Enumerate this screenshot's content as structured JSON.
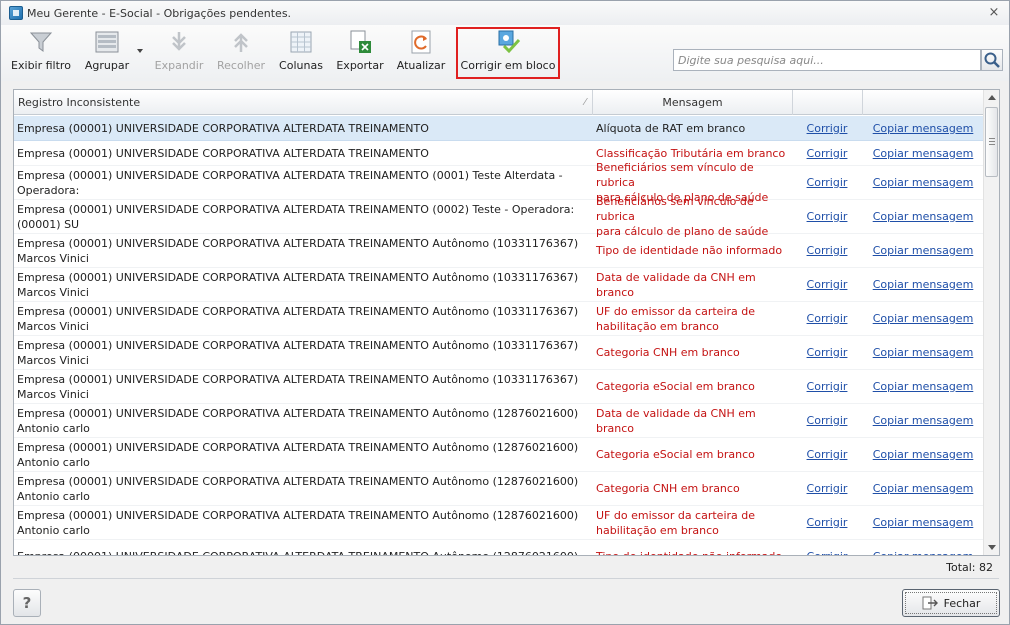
{
  "window": {
    "title": "Meu Gerente - E-Social - Obrigações pendentes.",
    "close_glyph": "×"
  },
  "toolbar": {
    "buttons": [
      {
        "label": "Exibir filtro",
        "icon": "funnel-icon",
        "enabled": true
      },
      {
        "label": "Agrupar",
        "icon": "group-icon",
        "enabled": true
      },
      {
        "label": "Expandir",
        "icon": "expand-icon",
        "enabled": false
      },
      {
        "label": "Recolher",
        "icon": "collapse-icon",
        "enabled": false
      },
      {
        "label": "Colunas",
        "icon": "columns-icon",
        "enabled": true
      },
      {
        "label": "Exportar",
        "icon": "export-excel-icon",
        "enabled": true
      },
      {
        "label": "Atualizar",
        "icon": "refresh-icon",
        "enabled": true
      },
      {
        "label": "Corrigir em bloco",
        "icon": "bulk-fix-icon",
        "enabled": true
      }
    ],
    "highlight_color": "#e02020"
  },
  "search": {
    "placeholder": "Digite sua pesquisa aqui...",
    "value": ""
  },
  "grid": {
    "columns": [
      "Registro Inconsistente",
      "Mensagem",
      "",
      ""
    ],
    "sort_mark": "⁄",
    "rows": [
      {
        "registro": "Empresa (00001) UNIVERSIDADE CORPORATIVA ALTERDATA TREINAMENTO",
        "registro2": "",
        "mensagem": "Alíquota de RAT em branco",
        "mensagem2": "",
        "corrigir": "Corrigir",
        "copiar": "Copiar mensagem"
      },
      {
        "registro": "Empresa (00001) UNIVERSIDADE CORPORATIVA ALTERDATA TREINAMENTO",
        "registro2": "",
        "mensagem": "Classificação Tributária em branco",
        "mensagem2": "",
        "corrigir": "Corrigir",
        "copiar": "Copiar mensagem"
      },
      {
        "registro": "Empresa (00001) UNIVERSIDADE CORPORATIVA ALTERDATA TREINAMENTO  (0001) Teste Alterdata -",
        "registro2": "Operadora:",
        "mensagem": "Beneficiários sem vínculo de rubrica",
        "mensagem2": "para cálculo de plano de saúde",
        "corrigir": "Corrigir",
        "copiar": "Copiar mensagem"
      },
      {
        "registro": "Empresa (00001) UNIVERSIDADE CORPORATIVA ALTERDATA TREINAMENTO  (0002) Teste - Operadora:",
        "registro2": "(00001) SU",
        "mensagem": "Beneficiários sem vínculo de rubrica",
        "mensagem2": "para cálculo de plano de saúde",
        "corrigir": "Corrigir",
        "copiar": "Copiar mensagem"
      },
      {
        "registro": "Empresa (00001) UNIVERSIDADE CORPORATIVA ALTERDATA TREINAMENTO  Autônomo (10331176367)",
        "registro2": "Marcos Vinici",
        "mensagem": "Tipo de identidade não informado",
        "mensagem2": "",
        "corrigir": "Corrigir",
        "copiar": "Copiar mensagem"
      },
      {
        "registro": "Empresa (00001) UNIVERSIDADE CORPORATIVA ALTERDATA TREINAMENTO  Autônomo (10331176367)",
        "registro2": "Marcos Vinici",
        "mensagem": "Data de validade da CNH em branco",
        "mensagem2": "",
        "corrigir": "Corrigir",
        "copiar": "Copiar mensagem"
      },
      {
        "registro": "Empresa (00001) UNIVERSIDADE CORPORATIVA ALTERDATA TREINAMENTO  Autônomo (10331176367)",
        "registro2": "Marcos Vinici",
        "mensagem": "UF do emissor da carteira de",
        "mensagem2": "habilitação em branco",
        "corrigir": "Corrigir",
        "copiar": "Copiar mensagem"
      },
      {
        "registro": "Empresa (00001) UNIVERSIDADE CORPORATIVA ALTERDATA TREINAMENTO  Autônomo (10331176367)",
        "registro2": "Marcos Vinici",
        "mensagem": "Categoria CNH em branco",
        "mensagem2": "",
        "corrigir": "Corrigir",
        "copiar": "Copiar mensagem"
      },
      {
        "registro": "Empresa (00001) UNIVERSIDADE CORPORATIVA ALTERDATA TREINAMENTO  Autônomo (10331176367)",
        "registro2": "Marcos Vinici",
        "mensagem": "Categoria eSocial em branco",
        "mensagem2": "",
        "corrigir": "Corrigir",
        "copiar": "Copiar mensagem"
      },
      {
        "registro": "Empresa (00001) UNIVERSIDADE CORPORATIVA ALTERDATA TREINAMENTO  Autônomo (12876021600)",
        "registro2": "Antonio carlo",
        "mensagem": "Data de validade da CNH em branco",
        "mensagem2": "",
        "corrigir": "Corrigir",
        "copiar": "Copiar mensagem"
      },
      {
        "registro": "Empresa (00001) UNIVERSIDADE CORPORATIVA ALTERDATA TREINAMENTO  Autônomo (12876021600)",
        "registro2": "Antonio carlo",
        "mensagem": "Categoria eSocial em branco",
        "mensagem2": "",
        "corrigir": "Corrigir",
        "copiar": "Copiar mensagem"
      },
      {
        "registro": "Empresa (00001) UNIVERSIDADE CORPORATIVA ALTERDATA TREINAMENTO  Autônomo (12876021600)",
        "registro2": "Antonio carlo",
        "mensagem": "Categoria CNH em branco",
        "mensagem2": "",
        "corrigir": "Corrigir",
        "copiar": "Copiar mensagem"
      },
      {
        "registro": "Empresa (00001) UNIVERSIDADE CORPORATIVA ALTERDATA TREINAMENTO  Autônomo (12876021600)",
        "registro2": "Antonio carlo",
        "mensagem": "UF do emissor da carteira de",
        "mensagem2": "habilitação em branco",
        "corrigir": "Corrigir",
        "copiar": "Copiar mensagem"
      },
      {
        "registro": "Empresa (00001) UNIVERSIDADE CORPORATIVA ALTERDATA TREINAMENTO  Autônomo (12876021600)",
        "registro2": "",
        "mensagem": "Tipo de identidade não informado",
        "mensagem2": "",
        "corrigir": "Corrigir",
        "copiar": "Copiar mensagem"
      }
    ]
  },
  "footer": {
    "total": "Total: 82",
    "help_label": "?",
    "close_label": "Fechar"
  }
}
